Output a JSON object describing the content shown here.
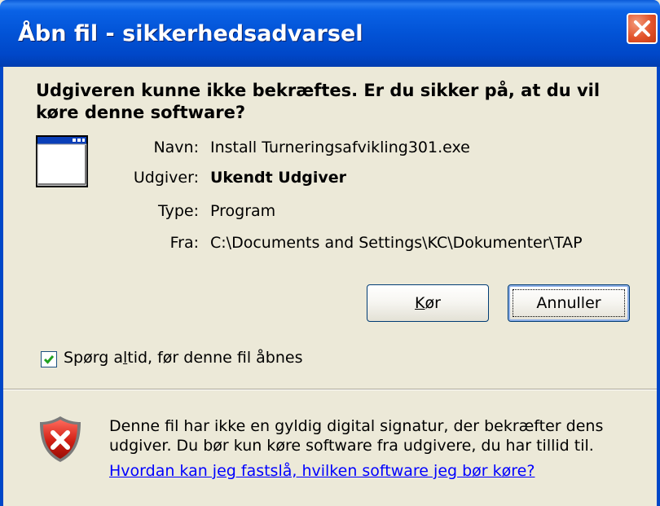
{
  "window": {
    "title": "Åbn fil - sikkerhedsadvarsel"
  },
  "headline": "Udgiveren kunne ikke bekræftes.  Er du sikker på, at du vil køre denne software?",
  "properties": [
    {
      "label": "Navn:",
      "value": "Install Turneringsafvikling301.exe"
    },
    {
      "label": "Udgiver:",
      "value": "Ukendt Udgiver"
    },
    {
      "label": "Type:",
      "value": "Program"
    },
    {
      "label": "Fra:",
      "value": "C:\\Documents and Settings\\KC\\Dokumenter\\TAP"
    }
  ],
  "buttons": {
    "run": {
      "pre": "",
      "accel": "K",
      "post": "ør"
    },
    "cancel": "Annuller"
  },
  "checkbox": {
    "checked": true,
    "label_pre": "Spørg a",
    "label_accel": "l",
    "label_post": "tid, før denne fil åbnes"
  },
  "info": {
    "text": "Denne fil har ikke en gyldig digital signatur, der bekræfter dens udgiver.  Du bør kun køre software fra udgivere, du har tillid til.",
    "link": "Hvordan kan jeg fastslå, hvilken software jeg bør køre?"
  },
  "colors": {
    "titlebar": "#0053D6",
    "dialog_bg": "#ECE9D8",
    "link": "#0000FF",
    "close_button": "#E2532B"
  },
  "icons": {
    "program": "program-window-icon",
    "warning": "warning-shield-icon",
    "close": "close-icon",
    "check": "checkmark-icon"
  }
}
